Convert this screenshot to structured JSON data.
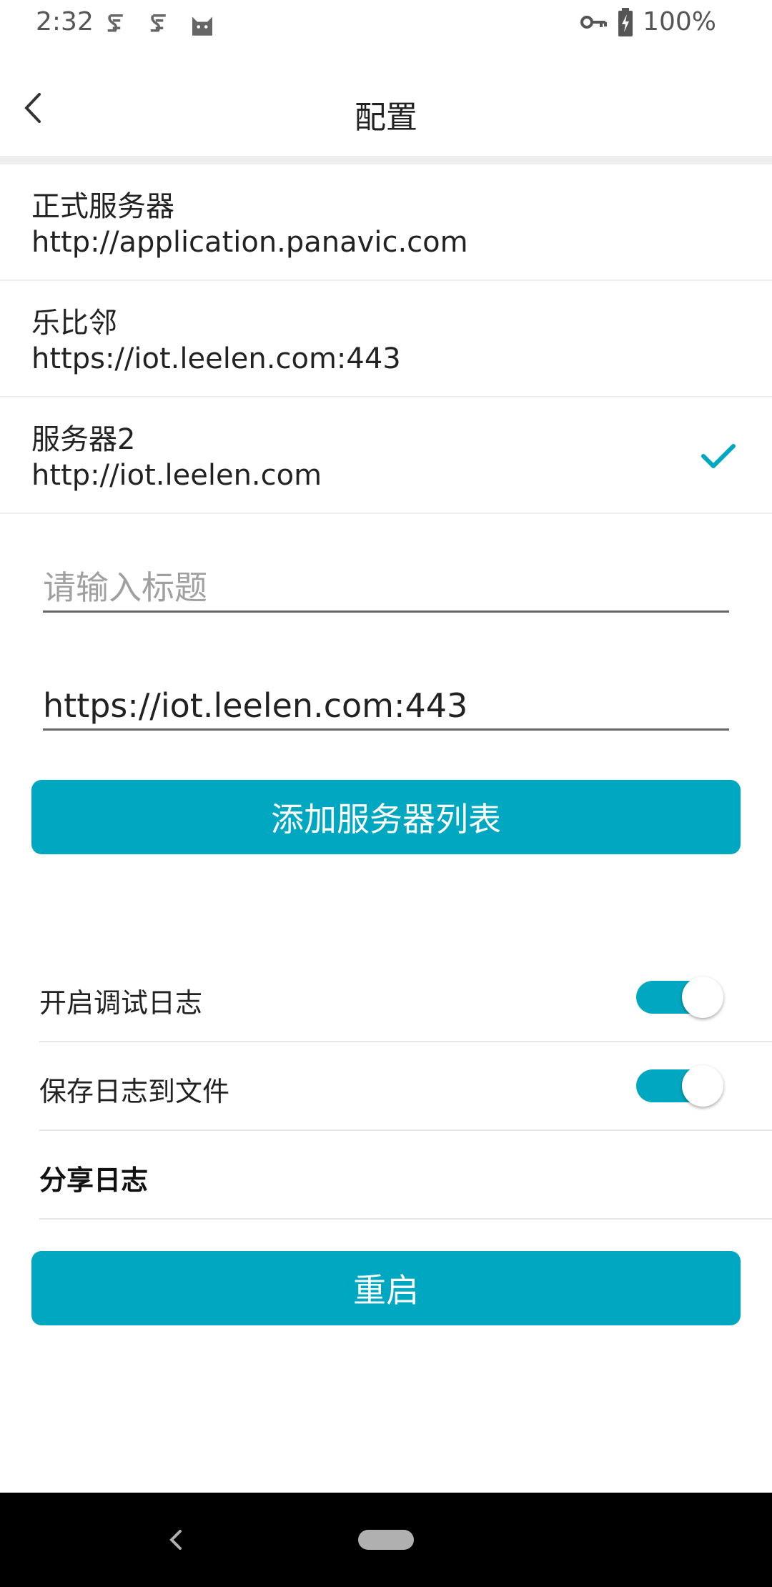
{
  "status_bar": {
    "time": "2:32",
    "battery": "100%",
    "icons": [
      "notification-s-icon",
      "notification-s-icon",
      "cat-icon",
      "vpn-key-icon",
      "battery-charging-icon"
    ]
  },
  "toolbar": {
    "title": "配置",
    "back_icon": "chevron-left-icon"
  },
  "servers": [
    {
      "name": "正式服务器",
      "url": "http://application.panavic.com",
      "selected": false
    },
    {
      "name": "乐比邻",
      "url": "https://iot.leelen.com:443",
      "selected": false
    },
    {
      "name": "服务器2",
      "url": "http://iot.leelen.com",
      "selected": true
    }
  ],
  "form": {
    "title_placeholder": "请输入标题",
    "title_value": "",
    "url_value": "https://iot.leelen.com:443",
    "add_button": "添加服务器列表"
  },
  "settings": {
    "debug_log": {
      "label": "开启调试日志",
      "enabled": true
    },
    "save_log": {
      "label": "保存日志到文件",
      "enabled": true
    },
    "share_log": {
      "label": "分享日志"
    }
  },
  "restart_button": "重启",
  "colors": {
    "accent": "#00a7c0",
    "divider": "#eeeeee",
    "text": "#222222",
    "placeholder": "#a0a0a0"
  }
}
